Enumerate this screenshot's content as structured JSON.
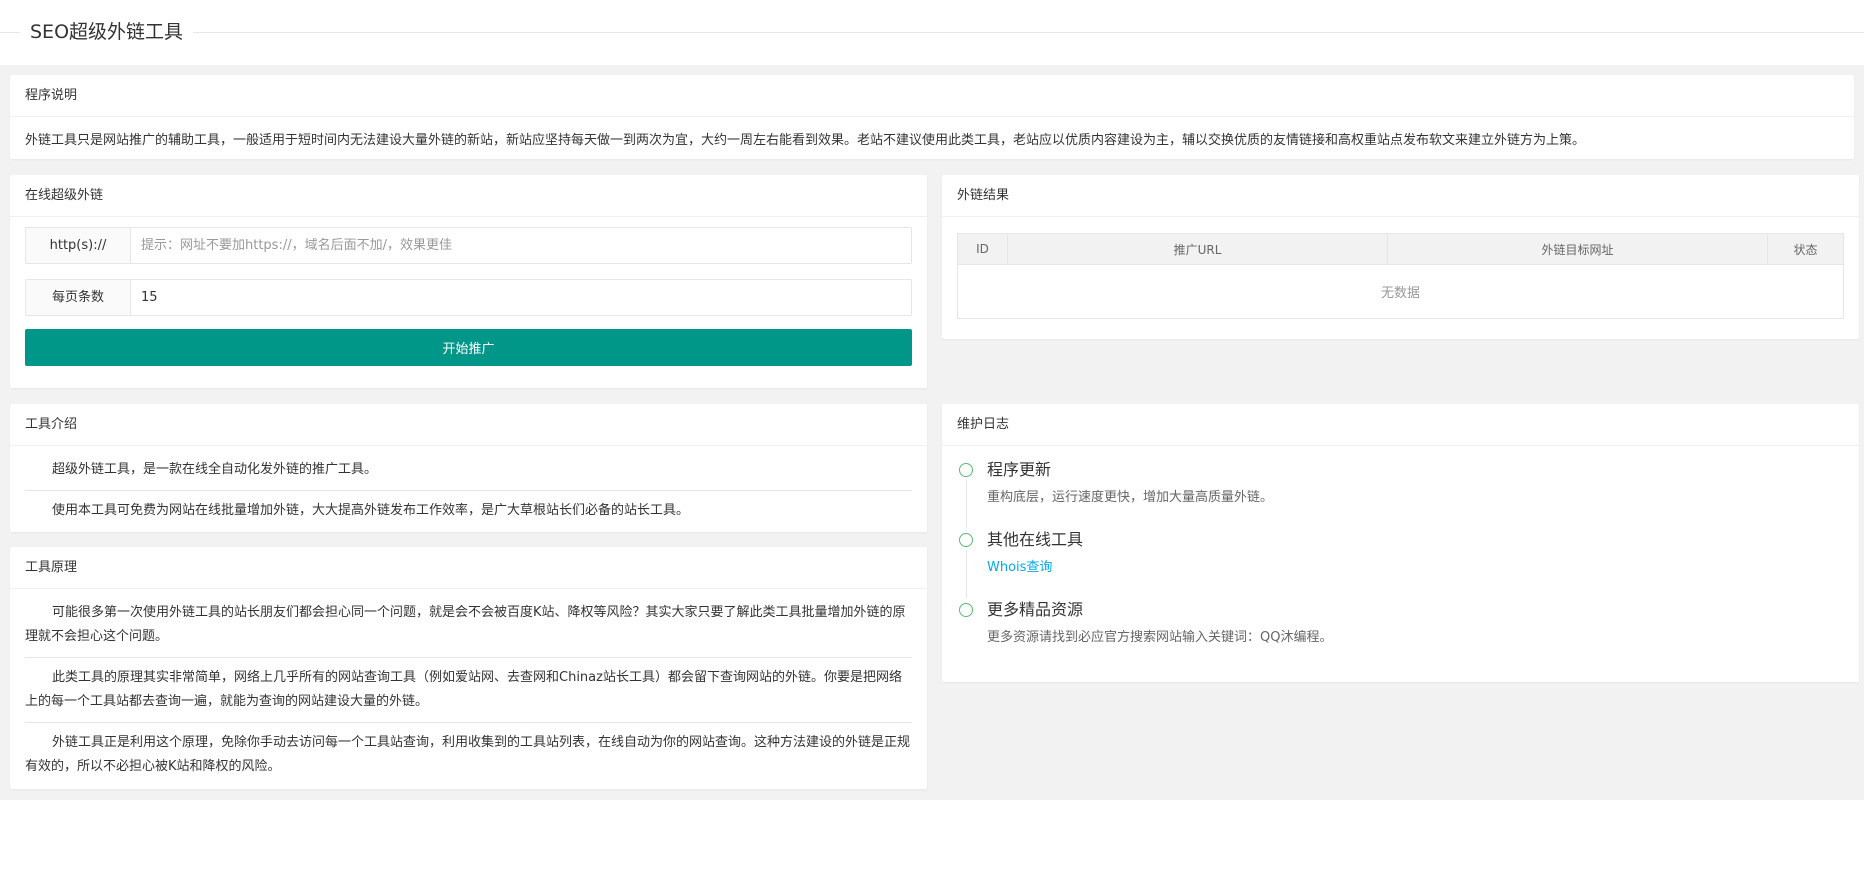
{
  "header": {
    "title": "SEO超级外链工具"
  },
  "desc": {
    "title": "程序说明",
    "text": "外链工具只是网站推广的辅助工具，一般适用于短时间内无法建设大量外链的新站，新站应坚持每天做一到两次为宜，大约一周左右能看到效果。老站不建议使用此类工具，老站应以优质内容建设为主，辅以交换优质的友情链接和高权重站点发布软文来建立外链方为上策。"
  },
  "form": {
    "title": "在线超级外链",
    "url_label": "http(s)://",
    "url_placeholder": "提示：网址不要加https://，域名后面不加/，效果更佳",
    "count_label": "每页条数",
    "count_value": "15",
    "start_button": "开始推广"
  },
  "result": {
    "title": "外链结果",
    "columns": [
      "ID",
      "推广URL",
      "外链目标网址",
      "状态"
    ],
    "empty_text": "无数据"
  },
  "intro": {
    "title": "工具介绍",
    "paragraphs": [
      "超级外链工具，是一款在线全自动化发外链的推广工具。",
      "使用本工具可免费为网站在线批量增加外链，大大提高外链发布工作效率，是广大草根站长们必备的站长工具。"
    ]
  },
  "principle": {
    "title": "工具原理",
    "paragraphs": [
      "可能很多第一次使用外链工具的站长朋友们都会担心同一个问题，就是会不会被百度K站、降权等风险？其实大家只要了解此类工具批量增加外链的原理就不会担心这个问题。",
      "此类工具的原理其实非常简单，网络上几乎所有的网站查询工具（例如爱站网、去查网和Chinaz站长工具）都会留下查询网站的外链。你要是把网络上的每一个工具站都去查询一遍，就能为查询的网站建设大量的外链。",
      "外链工具正是利用这个原理，免除你手动去访问每一个工具站查询，利用收集到的工具站列表，在线自动为你的网站查询。这种方法建设的外链是正规有效的，所以不必担心被K站和降权的风险。"
    ]
  },
  "log": {
    "title": "维护日志",
    "items": [
      {
        "title": "程序更新",
        "text": "重构底层，运行速度更快，增加大量高质量外链。"
      },
      {
        "title": "其他在线工具",
        "link": "Whois查询"
      },
      {
        "title": "更多精品资源",
        "text": "更多资源请找到必应官方搜索网站输入关键词：QQ沐编程。"
      }
    ]
  },
  "colors": {
    "primary": "#009688",
    "link": "#01AAED",
    "timeline": "#5FB878"
  }
}
